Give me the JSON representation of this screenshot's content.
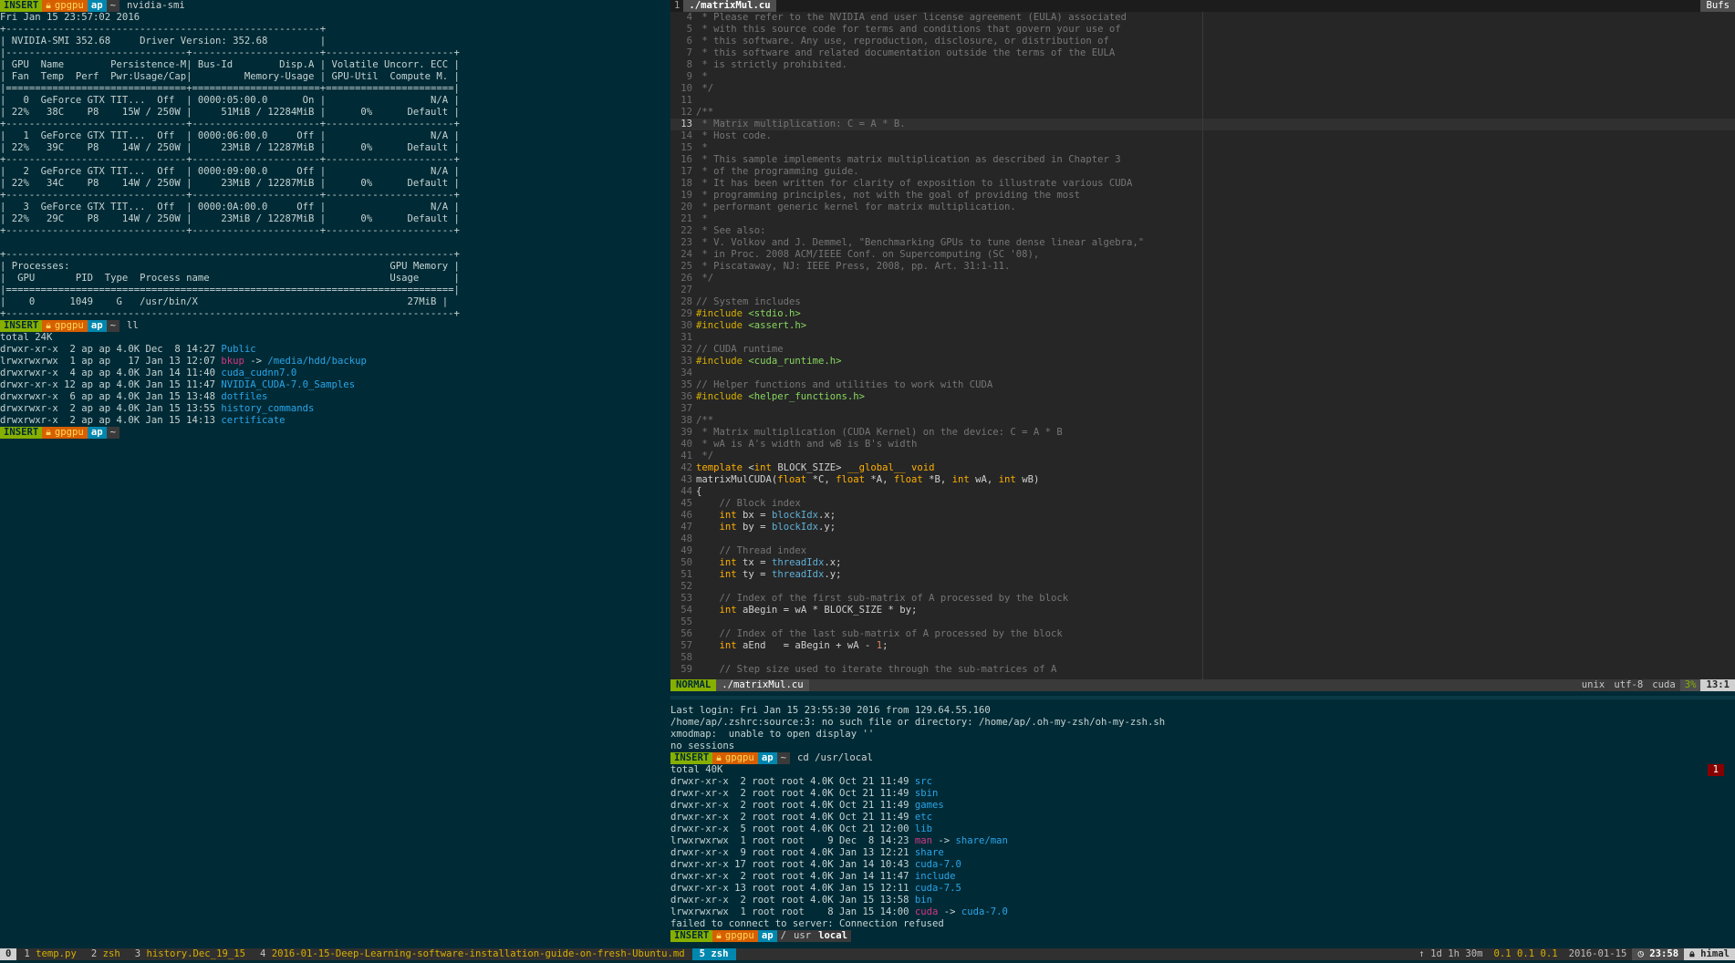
{
  "left_terminal": {
    "prompt1": {
      "mode": "INSERT",
      "host": "gpgpu",
      "user": "ap",
      "dir": "~",
      "command": "nvidia-smi"
    },
    "smi_lines": [
      "Fri Jan 15 23:57:02 2016",
      "+------------------------------------------------------+",
      "| NVIDIA-SMI 352.68     Driver Version: 352.68         |",
      "|-------------------------------+----------------------+----------------------+",
      "| GPU  Name        Persistence-M| Bus-Id        Disp.A | Volatile Uncorr. ECC |",
      "| Fan  Temp  Perf  Pwr:Usage/Cap|         Memory-Usage | GPU-Util  Compute M. |",
      "|===============================+======================+======================|",
      "|   0  GeForce GTX TIT...  Off  | 0000:05:00.0      On |                  N/A |",
      "| 22%   38C    P8    15W / 250W |     51MiB / 12284MiB |      0%      Default |",
      "+-------------------------------+----------------------+----------------------+",
      "|   1  GeForce GTX TIT...  Off  | 0000:06:00.0     Off |                  N/A |",
      "| 22%   39C    P8    14W / 250W |     23MiB / 12287MiB |      0%      Default |",
      "+-------------------------------+----------------------+----------------------+",
      "|   2  GeForce GTX TIT...  Off  | 0000:09:00.0     Off |                  N/A |",
      "| 22%   34C    P8    14W / 250W |     23MiB / 12287MiB |      0%      Default |",
      "+-------------------------------+----------------------+----------------------+",
      "|   3  GeForce GTX TIT...  Off  | 0000:0A:00.0     Off |                  N/A |",
      "| 22%   29C    P8    14W / 250W |     23MiB / 12287MiB |      0%      Default |",
      "+-------------------------------+----------------------+----------------------+",
      "",
      "+-----------------------------------------------------------------------------+",
      "| Processes:                                                       GPU Memory |",
      "|  GPU       PID  Type  Process name                               Usage      |",
      "|=============================================================================|",
      "|    0      1049    G   /usr/bin/X                                    27MiB |",
      "+-----------------------------------------------------------------------------+"
    ],
    "prompt2": {
      "mode": "INSERT",
      "host": "gpgpu",
      "user": "ap",
      "dir": "~",
      "command": "ll"
    },
    "ll_total": "total 24K",
    "ll_entries": [
      {
        "meta": "drwxr-xr-x  2 ap ap 4.0K Dec  8 14:27 ",
        "name": "Public",
        "link": "",
        "target": ""
      },
      {
        "meta": "lrwxrwxrwx  1 ap ap   17 Jan 13 12:07 ",
        "name": "bkup",
        "link": " -> ",
        "target": "/media/hdd/backup"
      },
      {
        "meta": "drwxrwxr-x  4 ap ap 4.0K Jan 14 11:40 ",
        "name": "cuda_cudnn7.0",
        "link": "",
        "target": ""
      },
      {
        "meta": "drwxr-xr-x 12 ap ap 4.0K Jan 15 11:47 ",
        "name": "NVIDIA_CUDA-7.0_Samples",
        "link": "",
        "target": ""
      },
      {
        "meta": "drwxrwxr-x  6 ap ap 4.0K Jan 15 13:48 ",
        "name": "dotfiles",
        "link": "",
        "target": ""
      },
      {
        "meta": "drwxrwxr-x  2 ap ap 4.0K Jan 15 13:55 ",
        "name": "history_commands",
        "link": "",
        "target": ""
      },
      {
        "meta": "drwxrwxr-x  2 ap ap 4.0K Jan 15 14:13 ",
        "name": "certificate",
        "link": "",
        "target": ""
      }
    ],
    "prompt3": {
      "mode": "INSERT",
      "host": "gpgpu",
      "user": "ap",
      "dir": "~",
      "command": ""
    }
  },
  "editor": {
    "tab_number": "1",
    "tab_file": "./matrixMul.cu",
    "bufs_label": "Bufs",
    "current_line": "13",
    "lines": [
      {
        "n": "4",
        "t": [
          [
            "c",
            " * Please refer to the NVIDIA end user license agreement (EULA) associated"
          ]
        ]
      },
      {
        "n": "5",
        "t": [
          [
            "c",
            " * with this source code for terms and conditions that govern your use of"
          ]
        ]
      },
      {
        "n": "6",
        "t": [
          [
            "c",
            " * this software. Any use, reproduction, disclosure, or distribution of"
          ]
        ]
      },
      {
        "n": "7",
        "t": [
          [
            "c",
            " * this software and related documentation outside the terms of the EULA"
          ]
        ]
      },
      {
        "n": "8",
        "t": [
          [
            "c",
            " * is strictly prohibited."
          ]
        ]
      },
      {
        "n": "9",
        "t": [
          [
            "c",
            " *"
          ]
        ]
      },
      {
        "n": "10",
        "t": [
          [
            "c",
            " */"
          ]
        ]
      },
      {
        "n": "11",
        "t": []
      },
      {
        "n": "12",
        "t": [
          [
            "c",
            "/**"
          ]
        ]
      },
      {
        "n": "13",
        "t": [
          [
            "c",
            " * Matrix multiplication: C = A * B."
          ]
        ]
      },
      {
        "n": "14",
        "t": [
          [
            "c",
            " * Host code."
          ]
        ]
      },
      {
        "n": "15",
        "t": [
          [
            "c",
            " *"
          ]
        ]
      },
      {
        "n": "16",
        "t": [
          [
            "c",
            " * This sample implements matrix multiplication as described in Chapter 3"
          ]
        ]
      },
      {
        "n": "17",
        "t": [
          [
            "c",
            " * of the programming guide."
          ]
        ]
      },
      {
        "n": "18",
        "t": [
          [
            "c",
            " * It has been written for clarity of exposition to illustrate various CUDA"
          ]
        ]
      },
      {
        "n": "19",
        "t": [
          [
            "c",
            " * programming principles, not with the goal of providing the most"
          ]
        ]
      },
      {
        "n": "20",
        "t": [
          [
            "c",
            " * performant generic kernel for matrix multiplication."
          ]
        ]
      },
      {
        "n": "21",
        "t": [
          [
            "c",
            " *"
          ]
        ]
      },
      {
        "n": "22",
        "t": [
          [
            "c",
            " * See also:"
          ]
        ]
      },
      {
        "n": "23",
        "t": [
          [
            "c",
            " * V. Volkov and J. Demmel, \"Benchmarking GPUs to tune dense linear algebra,\""
          ]
        ]
      },
      {
        "n": "24",
        "t": [
          [
            "c",
            " * in Proc. 2008 ACM/IEEE Conf. on Supercomputing (SC '08),"
          ]
        ]
      },
      {
        "n": "25",
        "t": [
          [
            "c",
            " * Piscataway, NJ: IEEE Press, 2008, pp. Art. 31:1-11."
          ]
        ]
      },
      {
        "n": "26",
        "t": [
          [
            "c",
            " */"
          ]
        ]
      },
      {
        "n": "27",
        "t": []
      },
      {
        "n": "28",
        "t": [
          [
            "c",
            "// System includes"
          ]
        ]
      },
      {
        "n": "29",
        "t": [
          [
            "pre",
            "#include "
          ],
          [
            "str",
            "<stdio.h>"
          ]
        ]
      },
      {
        "n": "30",
        "t": [
          [
            "pre",
            "#include "
          ],
          [
            "str",
            "<assert.h>"
          ]
        ]
      },
      {
        "n": "31",
        "t": []
      },
      {
        "n": "32",
        "t": [
          [
            "c",
            "// CUDA runtime"
          ]
        ]
      },
      {
        "n": "33",
        "t": [
          [
            "pre",
            "#include "
          ],
          [
            "str",
            "<cuda_runtime.h>"
          ]
        ]
      },
      {
        "n": "34",
        "t": []
      },
      {
        "n": "35",
        "t": [
          [
            "c",
            "// Helper functions and utilities to work with CUDA"
          ]
        ]
      },
      {
        "n": "36",
        "t": [
          [
            "pre",
            "#include "
          ],
          [
            "str",
            "<helper_functions.h>"
          ]
        ]
      },
      {
        "n": "37",
        "t": []
      },
      {
        "n": "38",
        "t": [
          [
            "c",
            "/**"
          ]
        ]
      },
      {
        "n": "39",
        "t": [
          [
            "c",
            " * Matrix multiplication (CUDA Kernel) on the device: C = A * B"
          ]
        ]
      },
      {
        "n": "40",
        "t": [
          [
            "c",
            " * wA is A's width and wB is B's width"
          ]
        ]
      },
      {
        "n": "41",
        "t": [
          [
            "c",
            " */"
          ]
        ]
      },
      {
        "n": "42",
        "t": [
          [
            "kw",
            "template "
          ],
          [
            "p",
            "<"
          ],
          [
            "type",
            "int"
          ],
          [
            "p",
            " BLOCK_SIZE> "
          ],
          [
            "kw",
            "__global__ void"
          ]
        ]
      },
      {
        "n": "43",
        "t": [
          [
            "p",
            "matrixMulCUDA("
          ],
          [
            "type",
            "float"
          ],
          [
            "p",
            " *C, "
          ],
          [
            "type",
            "float"
          ],
          [
            "p",
            " *A, "
          ],
          [
            "type",
            "float"
          ],
          [
            "p",
            " *B, "
          ],
          [
            "type",
            "int"
          ],
          [
            "p",
            " wA, "
          ],
          [
            "type",
            "int"
          ],
          [
            "p",
            " wB)"
          ]
        ]
      },
      {
        "n": "44",
        "t": [
          [
            "p",
            "{"
          ]
        ]
      },
      {
        "n": "45",
        "t": [
          [
            "c",
            "    // Block index"
          ]
        ]
      },
      {
        "n": "46",
        "t": [
          [
            "type",
            "    int"
          ],
          [
            "p",
            " bx = "
          ],
          [
            "var",
            "blockIdx"
          ],
          [
            "p",
            ".x;"
          ]
        ]
      },
      {
        "n": "47",
        "t": [
          [
            "type",
            "    int"
          ],
          [
            "p",
            " by = "
          ],
          [
            "var",
            "blockIdx"
          ],
          [
            "p",
            ".y;"
          ]
        ]
      },
      {
        "n": "48",
        "t": []
      },
      {
        "n": "49",
        "t": [
          [
            "c",
            "    // Thread index"
          ]
        ]
      },
      {
        "n": "50",
        "t": [
          [
            "type",
            "    int"
          ],
          [
            "p",
            " tx = "
          ],
          [
            "var",
            "threadIdx"
          ],
          [
            "p",
            ".x;"
          ]
        ]
      },
      {
        "n": "51",
        "t": [
          [
            "type",
            "    int"
          ],
          [
            "p",
            " ty = "
          ],
          [
            "var",
            "threadIdx"
          ],
          [
            "p",
            ".y;"
          ]
        ]
      },
      {
        "n": "52",
        "t": []
      },
      {
        "n": "53",
        "t": [
          [
            "c",
            "    // Index of the first sub-matrix of A processed by the block"
          ]
        ]
      },
      {
        "n": "54",
        "t": [
          [
            "type",
            "    int"
          ],
          [
            "p",
            " aBegin = wA * BLOCK_SIZE * by;"
          ]
        ]
      },
      {
        "n": "55",
        "t": []
      },
      {
        "n": "56",
        "t": [
          [
            "c",
            "    // Index of the last sub-matrix of A processed by the block"
          ]
        ]
      },
      {
        "n": "57",
        "t": [
          [
            "type",
            "    int"
          ],
          [
            "p",
            " aEnd   = aBegin + wA - "
          ],
          [
            "num",
            "1"
          ],
          [
            "p",
            ";"
          ]
        ]
      },
      {
        "n": "58",
        "t": []
      },
      {
        "n": "59",
        "t": [
          [
            "c",
            "    // Step size used to iterate through the sub-matrices of A"
          ]
        ]
      }
    ],
    "status": {
      "mode": "NORMAL",
      "file": "./matrixMul.cu",
      "format": "unix",
      "encoding": "utf-8",
      "filetype": "cuda",
      "percent": "3%",
      "position": "13:1"
    }
  },
  "right_terminal": {
    "login_lines": [
      "Last login: Fri Jan 15 23:55:30 2016 from 129.64.55.160",
      "/home/ap/.zshrc:source:3: no such file or directory: /home/ap/.oh-my-zsh/oh-my-zsh.sh",
      "xmodmap:  unable to open display ''",
      "no sessions"
    ],
    "prompt1": {
      "mode": "INSERT",
      "host": "gpgpu",
      "user": "ap",
      "dir": "~",
      "command": "cd /usr/local"
    },
    "error_badge": "1",
    "ll_total": "total 40K",
    "ll_entries": [
      {
        "meta": "drwxr-xr-x  2 root root 4.0K Oct 21 11:49 ",
        "name": "src",
        "link": "",
        "target": ""
      },
      {
        "meta": "drwxr-xr-x  2 root root 4.0K Oct 21 11:49 ",
        "name": "sbin",
        "link": "",
        "target": ""
      },
      {
        "meta": "drwxr-xr-x  2 root root 4.0K Oct 21 11:49 ",
        "name": "games",
        "link": "",
        "target": ""
      },
      {
        "meta": "drwxr-xr-x  2 root root 4.0K Oct 21 11:49 ",
        "name": "etc",
        "link": "",
        "target": ""
      },
      {
        "meta": "drwxr-xr-x  5 root root 4.0K Oct 21 12:00 ",
        "name": "lib",
        "link": "",
        "target": ""
      },
      {
        "meta": "lrwxrwxrwx  1 root root    9 Dec  8 14:23 ",
        "name": "man",
        "link": " -> ",
        "target": "share/man"
      },
      {
        "meta": "drwxr-xr-x  9 root root 4.0K Jan 13 12:21 ",
        "name": "share",
        "link": "",
        "target": ""
      },
      {
        "meta": "drwxr-xr-x 17 root root 4.0K Jan 14 10:43 ",
        "name": "cuda-7.0",
        "link": "",
        "target": ""
      },
      {
        "meta": "drwxr-xr-x  2 root root 4.0K Jan 14 11:47 ",
        "name": "include",
        "link": "",
        "target": ""
      },
      {
        "meta": "drwxr-xr-x 13 root root 4.0K Jan 15 12:11 ",
        "name": "cuda-7.5",
        "link": "",
        "target": ""
      },
      {
        "meta": "drwxr-xr-x  2 root root 4.0K Jan 15 13:58 ",
        "name": "bin",
        "link": "",
        "target": ""
      },
      {
        "meta": "lrwxrwxrwx  1 root root    8 Jan 15 14:00 ",
        "name": "cuda",
        "link": " -> ",
        "target": "cuda-7.0"
      }
    ],
    "error_line": "failed to connect to server: Connection refused",
    "prompt2": {
      "mode": "INSERT",
      "host": "gpgpu",
      "user": "ap",
      "dir": "/",
      "dir2": "usr",
      "dir3": "local",
      "command": ""
    }
  },
  "tmux": {
    "session": "0",
    "windows": [
      {
        "num": "1",
        "name": "temp.py",
        "active": false
      },
      {
        "num": "2",
        "name": "zsh",
        "active": false
      },
      {
        "num": "3",
        "name": "history.Dec_19_15",
        "active": false
      },
      {
        "num": "4",
        "name": "2016-01-15-Deep-Learning-software-installation-guide-on-fresh-Ubuntu.md",
        "active": false
      },
      {
        "num": "5",
        "name": "zsh",
        "active": true
      }
    ],
    "uptime": "1d 1h 30m",
    "load": "0.1 0.1 0.1",
    "date": "2016-01-15",
    "time": "23:58",
    "hostname": "himal"
  },
  "colors": {
    "terminal_bg": "#002b36",
    "editor_bg": "#262626",
    "mode_green": "#87af00",
    "host_orange": "#d75f00",
    "user_blue": "#0087af",
    "dir_blue": "#2aa4e8",
    "link_magenta": "#d33682"
  }
}
